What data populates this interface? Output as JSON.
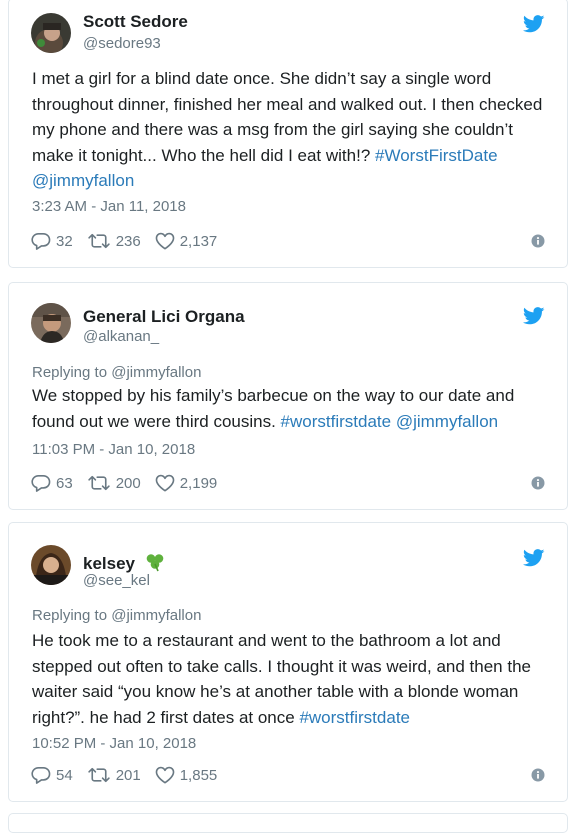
{
  "colors": {
    "link": "#2b7bb9",
    "secondary_text": "#697882",
    "primary_text": "#1c2022",
    "twitter_blue": "#1da1f2",
    "card_border": "#e1e8ed"
  },
  "tweets": [
    {
      "name": "Scott Sedore",
      "handle": "@sedore93",
      "reply_to": "",
      "text": "I met a girl for a blind date once. She didn’t say a single word throughout dinner, finished her meal and walked out. I then checked my phone and there was a msg from the girl saying she couldn’t make it tonight... Who the hell did I eat with!?",
      "hashtags": [
        "#WorstFirstDate",
        "@jimmyfallon"
      ],
      "timestamp": "3:23 AM - Jan 11, 2018",
      "replies": "32",
      "retweets": "236",
      "likes": "2,137"
    },
    {
      "name": "General Lici Organa",
      "handle": "@alkanan_",
      "reply_to": "Replying to @jimmyfallon",
      "text": "We stopped by his family’s barbecue on the way to our date and found out we were third cousins.",
      "hashtags": [
        "#worstfirstdate",
        "@jimmyfallon"
      ],
      "timestamp": "11:03 PM - Jan 10, 2018",
      "replies": "63",
      "retweets": "200",
      "likes": "2,199"
    },
    {
      "name": "kelsey",
      "name_emoji": "shamrock-icon",
      "handle": "@see_kel",
      "reply_to": "Replying to @jimmyfallon",
      "text": "He took me to a restaurant and went to the bathroom a lot and stepped out often to take calls. I thought it was weird, and then the waiter said “you know he’s at another table with a blonde woman right?”. he had 2 first dates at once",
      "hashtags": [
        "#worstfirstdate"
      ],
      "timestamp": "10:52 PM - Jan 10, 2018",
      "replies": "54",
      "retweets": "201",
      "likes": "1,855"
    }
  ],
  "icons": {
    "brand": "twitter-bird-icon",
    "reply": "reply-icon",
    "retweet": "retweet-icon",
    "like": "heart-icon",
    "info": "info-icon"
  }
}
